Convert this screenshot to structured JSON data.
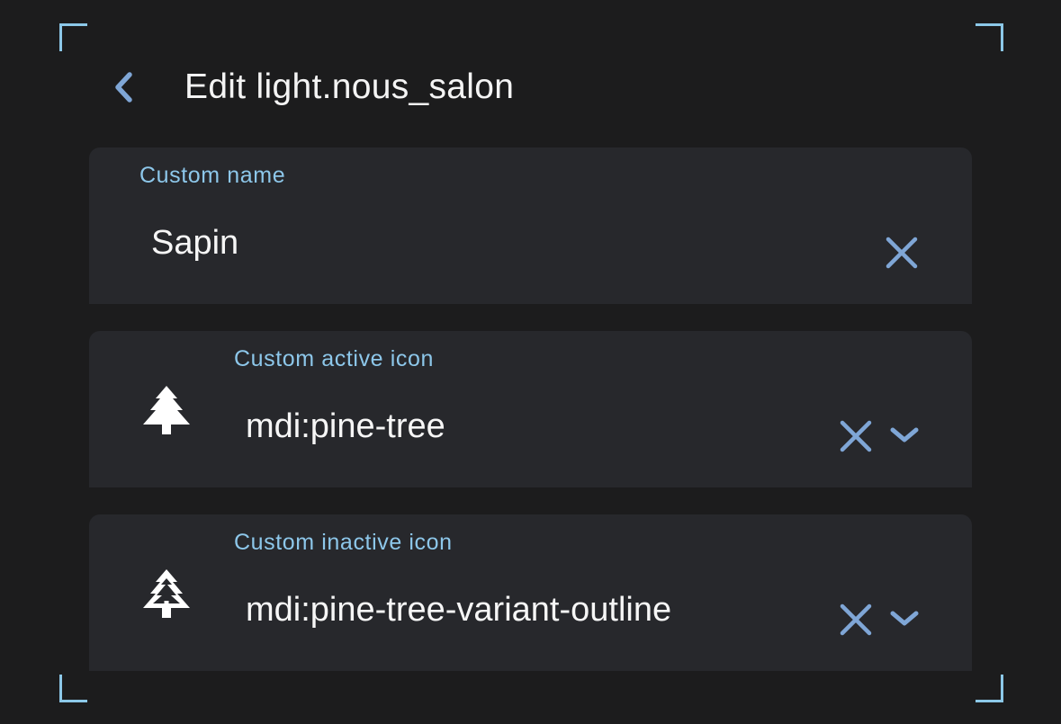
{
  "header": {
    "title": "Edit light.nous_salon",
    "back_icon": "chevron-left-icon"
  },
  "fields": {
    "name": {
      "label": "Custom name",
      "value": "Sapin",
      "clear_icon": "close-icon"
    },
    "active_icon": {
      "label": "Custom active icon",
      "value": "mdi:pine-tree",
      "preview_icon": "pine-tree-icon",
      "clear_icon": "close-icon",
      "dropdown_icon": "chevron-down-icon"
    },
    "inactive_icon": {
      "label": "Custom inactive icon",
      "value": "mdi:pine-tree-variant-outline",
      "preview_icon": "pine-tree-variant-outline-icon",
      "clear_icon": "close-icon",
      "dropdown_icon": "chevron-down-icon"
    }
  },
  "colors": {
    "background": "#1c1c1d",
    "field_background": "#27282c",
    "accent": "#7fa6d6",
    "label": "#8dc7ea",
    "text": "#f6f6f6",
    "frame": "#8cc8e8"
  }
}
